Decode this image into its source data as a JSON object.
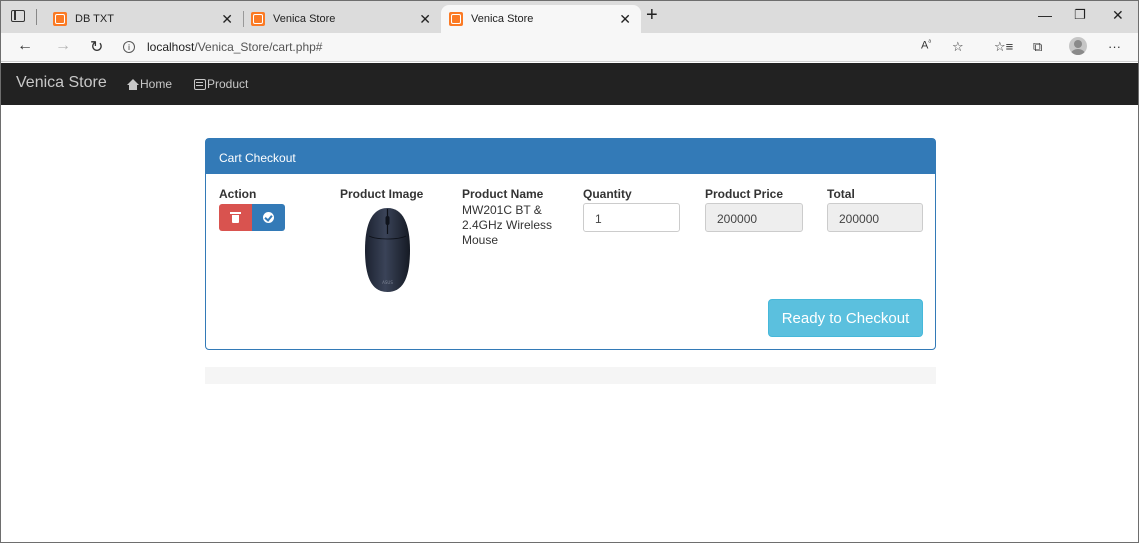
{
  "browser": {
    "tabs": [
      {
        "title": "DB TXT",
        "active": false
      },
      {
        "title": "Venica Store",
        "active": false
      },
      {
        "title": "Venica Store",
        "active": true
      }
    ],
    "url_host": "localhost",
    "url_path": "/Venica_Store/cart.php#",
    "icons": [
      "tab-actions-icon",
      "favicon-icon",
      "close-icon",
      "new-tab-icon",
      "minimize-icon",
      "restore-icon",
      "window-close-icon",
      "back-icon",
      "forward-icon",
      "refresh-icon",
      "info-icon",
      "read-aloud-icon",
      "add-favorite-icon",
      "favorites-icon",
      "collections-icon",
      "profile-icon",
      "more-icon"
    ]
  },
  "navbar": {
    "brand": "Venica Store",
    "links": [
      {
        "label": "Home",
        "icon": "home-icon"
      },
      {
        "label": "Product",
        "icon": "product-icon"
      }
    ]
  },
  "cart": {
    "heading": "Cart Checkout",
    "columns": {
      "action": "Action",
      "image": "Product Image",
      "name": "Product Name",
      "quantity": "Quantity",
      "price": "Product Price",
      "total": "Total"
    },
    "item": {
      "name": "MW201C BT & 2.4GHz Wireless Mouse",
      "quantity": "1",
      "price": "200000",
      "total": "200000"
    },
    "checkout_label": "Ready to Checkout"
  },
  "colors": {
    "primary": "#337ab7",
    "danger": "#d9534f",
    "info": "#5bc0de",
    "navbar": "#222222"
  }
}
